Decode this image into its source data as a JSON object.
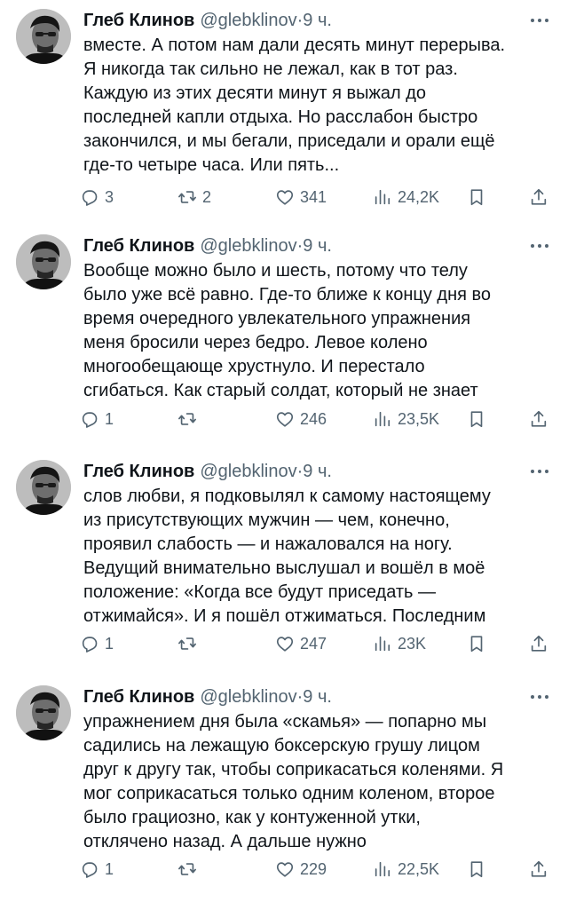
{
  "tweets": [
    {
      "author": "Глеб Клинов",
      "handle": "@glebklinov",
      "dot": "·",
      "time": "9 ч.",
      "lines": [
        "вместе. А потом нам дали десять минут перерыва.",
        "Я никогда так сильно не лежал, как в тот раз.",
        "Каждую из этих десяти минут я выжал до",
        "последней капли отдыха. Но расслабон быстро",
        "закончился, и мы бегали, приседали и орали ещё",
        "где-то четыре часа. Или пять..."
      ],
      "replies": "3",
      "retweets": "2",
      "likes": "341",
      "views": "24,2K"
    },
    {
      "author": "Глеб Клинов",
      "handle": "@glebklinov",
      "dot": "·",
      "time": "9 ч.",
      "lines": [
        "Вообще можно было и шесть, потому что телу",
        "было уже всё равно. Где-то ближе к концу дня во",
        "время очередного увлекательного упражнения",
        "меня бросили через бедро. Левое колено",
        "многообещающе хрустнуло. И перестало",
        "сгибаться. Как старый солдат, который не знает"
      ],
      "replies": "1",
      "retweets": "",
      "likes": "246",
      "views": "23,5K"
    },
    {
      "author": "Глеб Клинов",
      "handle": "@glebklinov",
      "dot": "·",
      "time": "9 ч.",
      "lines": [
        "слов любви, я подковылял к самому настоящему",
        "из присутствующих мужчин — чем, конечно,",
        "проявил слабость — и нажаловался на ногу.",
        "Ведущий внимательно выслушал и вошёл в моё",
        "положение: «Когда все будут приседать —",
        "отжимайся». И я пошёл отжиматься. Последним"
      ],
      "replies": "1",
      "retweets": "",
      "likes": "247",
      "views": "23K"
    },
    {
      "author": "Глеб Клинов",
      "handle": "@glebklinov",
      "dot": "·",
      "time": "9 ч.",
      "lines": [
        "упражнением дня была «скамья» — попарно мы",
        "садились на лежащую боксерскую грушу лицом",
        "друг к другу так, чтобы соприкасаться коленями. Я",
        "мог соприкасаться только одним коленом, второе",
        "было грациозно, как у контуженной утки,",
        "отклячено назад. А дальше нужно"
      ],
      "replies": "1",
      "retweets": "",
      "likes": "229",
      "views": "22,5K"
    }
  ],
  "icons": {
    "reply": "reply-icon",
    "retweet": "retweet-icon",
    "like": "heart-icon",
    "views": "views-icon",
    "bookmark": "bookmark-icon",
    "share": "share-icon",
    "more": "more-icon"
  },
  "colors": {
    "text": "#0f1419",
    "secondary": "#536471"
  }
}
